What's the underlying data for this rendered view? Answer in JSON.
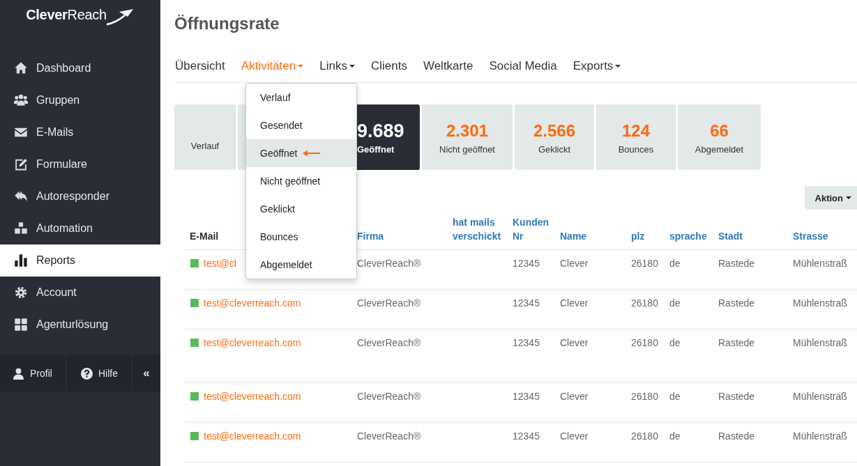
{
  "sidebar": {
    "logo": "**Clever**Reach",
    "items": [
      {
        "label": "Dashboard",
        "selected": false
      },
      {
        "label": "Gruppen",
        "selected": false
      },
      {
        "label": "E-Mails",
        "selected": false
      },
      {
        "label": "Formulare",
        "selected": false
      },
      {
        "label": "Autoresponder",
        "selected": false
      },
      {
        "label": "Automation",
        "selected": false
      },
      {
        "label": "Reports",
        "selected": true
      },
      {
        "label": "Account",
        "selected": false
      },
      {
        "label": "Agenturlösung",
        "selected": false
      }
    ],
    "footer": [
      {
        "kind": "profile",
        "label": "Profil"
      },
      {
        "kind": "help",
        "label": "Hilfe"
      },
      {
        "kind": "collapse",
        "label": "«"
      }
    ]
  },
  "page": {
    "title": "Öffnungsrate"
  },
  "tabs": [
    {
      "label": "Übersicht",
      "selected": false,
      "dropdown": false
    },
    {
      "label": "Aktivitäten",
      "selected": true,
      "dropdown": true
    },
    {
      "label": "Links",
      "selected": false,
      "dropdown": true
    },
    {
      "label": "Clients",
      "selected": false,
      "dropdown": false
    },
    {
      "label": "Weltkarte",
      "selected": false,
      "dropdown": false
    },
    {
      "label": "Social Media",
      "selected": false,
      "dropdown": false
    },
    {
      "label": "Exports",
      "selected": false,
      "dropdown": true
    }
  ],
  "menu": [
    {
      "label": "Verlauf",
      "selected": false
    },
    {
      "label": "Gesendet",
      "selected": false
    },
    {
      "label": "Geöffnet",
      "selected": true
    },
    {
      "label": "Nicht geöffnet",
      "selected": false
    },
    {
      "label": "Geklickt",
      "selected": false
    },
    {
      "label": "Bounces",
      "selected": false
    },
    {
      "label": "Abgemeldet",
      "selected": false
    }
  ],
  "stats": [
    {
      "kind": "label",
      "label": "Verlauf",
      "selected": false
    },
    {
      "kind": "covered"
    },
    {
      "kind": "value",
      "value": "9.689",
      "label": "Geöffnet",
      "selected": true
    },
    {
      "kind": "value",
      "value": "2.301",
      "label": "Nicht geöffnet",
      "selected": false
    },
    {
      "kind": "value",
      "value": "2.566",
      "label": "Geklickt",
      "selected": false
    },
    {
      "kind": "value",
      "value": "124",
      "label": "Bounces",
      "selected": false
    },
    {
      "kind": "value",
      "value": "66",
      "label": "Abgemeldet",
      "selected": false
    }
  ],
  "action_button": {
    "label": "Aktion"
  },
  "table": {
    "columns": [
      {
        "label": "E-Mail",
        "sortable": false
      },
      {
        "label": "Firma",
        "sortable": true
      },
      {
        "label": "hat mails verschickt",
        "sortable": true
      },
      {
        "label": "Kunden Nr",
        "sortable": true
      },
      {
        "label": "Name",
        "sortable": true
      },
      {
        "label": "plz",
        "sortable": true
      },
      {
        "label": "sprache",
        "sortable": true
      },
      {
        "label": "Stadt",
        "sortable": true
      },
      {
        "label": "Strasse",
        "sortable": true
      }
    ],
    "rows": [
      {
        "color": "#5cb85c",
        "cells": [
          "test@cl",
          "CleverReach®",
          "",
          "12345",
          "Clever",
          "26180",
          "de",
          "Rastede",
          "Mühlenstraß"
        ]
      },
      {
        "color": "#5cb85c",
        "cells": [
          "test@cleverreach.com",
          "CleverReach®",
          "",
          "12345",
          "Clever",
          "26180",
          "de",
          "Rastede",
          "Mühlenstraß"
        ]
      },
      {
        "color": "#5cb85c",
        "cells": [
          "test@cleverreach.com",
          "CleverReach®",
          "",
          "12345",
          "Clever",
          "26180",
          "de",
          "Rastede",
          "Mühlenstraß"
        ]
      },
      {
        "color": "#5cb85c",
        "cells": [
          "test@cleverreach.com",
          "CleverReach®",
          "",
          "12345",
          "Clever",
          "26180",
          "de",
          "Rastede",
          "Mühlenstraß"
        ]
      },
      {
        "color": "#5cb85c",
        "cells": [
          "test@cleverreach.com",
          "CleverReach®",
          "",
          "12345",
          "Clever",
          "26180",
          "de",
          "Rastede",
          "Mühlenstraß"
        ]
      }
    ]
  }
}
